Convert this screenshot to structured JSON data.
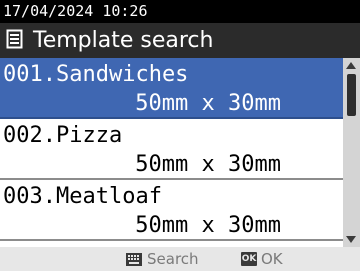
{
  "status": {
    "datetime": "17/04/2024 10:26"
  },
  "header": {
    "icon": "template-document-icon",
    "title": "Template search"
  },
  "templates": [
    {
      "name": "001.Sandwiches",
      "size": "50mm x 30mm",
      "selected": true
    },
    {
      "name": "002.Pizza",
      "size": "50mm x 30mm",
      "selected": false
    },
    {
      "name": "003.Meatloaf",
      "size": "50mm x 30mm",
      "selected": false
    }
  ],
  "scrollbar": {
    "icons": [
      "scroll-up-icon",
      "scroll-down-icon"
    ]
  },
  "footer": {
    "search": {
      "icon": "keyboard-icon",
      "label": "Search"
    },
    "ok": {
      "icon": "ok-key-icon",
      "key_label": "OK",
      "label": "OK"
    }
  },
  "colors": {
    "selected_row": "#3f67b2",
    "title_bar": "#2b2b2b",
    "status_bar": "#000000",
    "footer": "#e7e7e7"
  }
}
